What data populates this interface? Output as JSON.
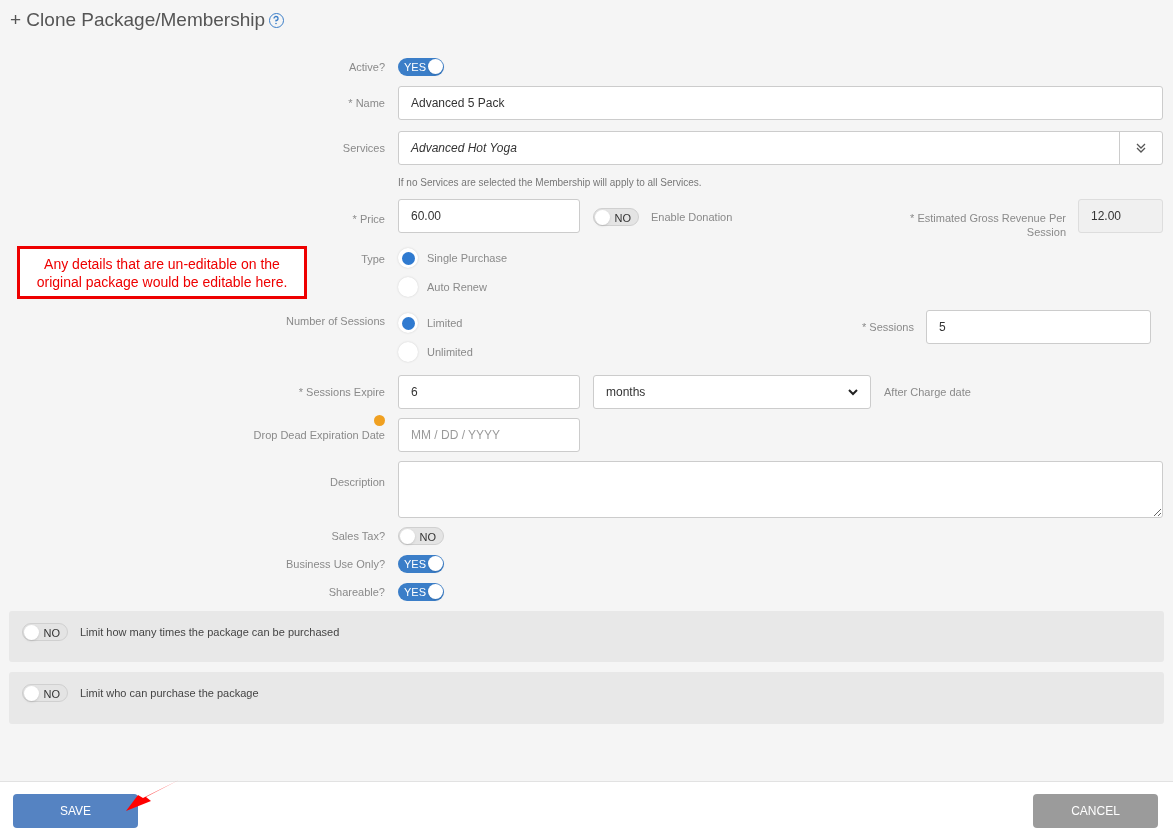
{
  "title": "+ Clone Package/Membership",
  "active": {
    "label": "Active?",
    "on": true,
    "text": "YES"
  },
  "name": {
    "label": "* Name",
    "value": "Advanced 5 Pack"
  },
  "services": {
    "label": "Services",
    "value": "Advanced Hot Yoga",
    "hint": "If no Services are selected the Membership will apply to all Services."
  },
  "price": {
    "label": "* Price",
    "value": "60.00"
  },
  "donation": {
    "on": false,
    "text": "NO",
    "label": "Enable Donation"
  },
  "revenue": {
    "label": "* Estimated Gross Revenue Per Session",
    "value": "12.00"
  },
  "type": {
    "label": "Type",
    "options": [
      {
        "label": "Single Purchase",
        "selected": true
      },
      {
        "label": "Auto Renew",
        "selected": false
      }
    ]
  },
  "number_of_sessions": {
    "label": "Number of Sessions",
    "options": [
      {
        "label": "Limited",
        "selected": true
      },
      {
        "label": "Unlimited",
        "selected": false
      }
    ]
  },
  "sessions": {
    "label": "* Sessions",
    "value": "5"
  },
  "sessions_expire": {
    "label": "* Sessions Expire",
    "value": "6",
    "unit": "months",
    "suffix": "After Charge date"
  },
  "drop_dead": {
    "label": "Drop Dead Expiration Date",
    "placeholder": "MM / DD / YYYY"
  },
  "description": {
    "label": "Description"
  },
  "flags": [
    {
      "label": "Sales Tax?",
      "on": false,
      "text": "NO"
    },
    {
      "label": "Business Use Only?",
      "on": true,
      "text": "YES"
    },
    {
      "label": "Shareable?",
      "on": true,
      "text": "YES"
    }
  ],
  "panels": [
    {
      "on": false,
      "text": "NO",
      "label": "Limit how many times the package can be purchased"
    },
    {
      "on": false,
      "text": "NO",
      "label": "Limit who can purchase the package"
    }
  ],
  "annotation": "Any details that are un-editable on the original package would be editable here.",
  "buttons": {
    "save": "SAVE",
    "cancel": "CANCEL"
  }
}
